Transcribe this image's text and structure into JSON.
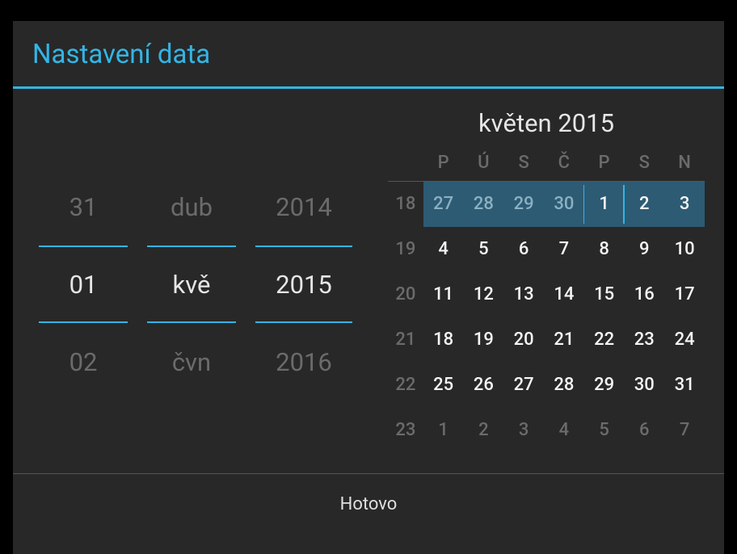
{
  "dialog": {
    "title": "Nastavení data",
    "done_label": "Hotovo"
  },
  "picker": {
    "day": {
      "prev": "31",
      "sel": "01",
      "next": "02"
    },
    "month": {
      "prev": "dub",
      "sel": "kvě",
      "next": "čvn"
    },
    "year": {
      "prev": "2014",
      "sel": "2015",
      "next": "2016"
    }
  },
  "calendar": {
    "month_label": "květen 2015",
    "weekday_short": [
      "P",
      "Ú",
      "S",
      "Č",
      "P",
      "S",
      "N"
    ],
    "weeks": [
      {
        "num": "18",
        "days": [
          {
            "d": "27",
            "other": true,
            "sel": true
          },
          {
            "d": "28",
            "other": true,
            "sel": true
          },
          {
            "d": "29",
            "other": true,
            "sel": true
          },
          {
            "d": "30",
            "other": true,
            "sel": true,
            "sep": true
          },
          {
            "d": "1",
            "other": false,
            "sel": true,
            "sep": true
          },
          {
            "d": "2",
            "other": false,
            "sel": true
          },
          {
            "d": "3",
            "other": false,
            "sel": true
          }
        ]
      },
      {
        "num": "19",
        "days": [
          {
            "d": "4"
          },
          {
            "d": "5"
          },
          {
            "d": "6"
          },
          {
            "d": "7"
          },
          {
            "d": "8"
          },
          {
            "d": "9"
          },
          {
            "d": "10"
          }
        ]
      },
      {
        "num": "20",
        "days": [
          {
            "d": "11"
          },
          {
            "d": "12"
          },
          {
            "d": "13"
          },
          {
            "d": "14"
          },
          {
            "d": "15"
          },
          {
            "d": "16"
          },
          {
            "d": "17"
          }
        ]
      },
      {
        "num": "21",
        "days": [
          {
            "d": "18"
          },
          {
            "d": "19"
          },
          {
            "d": "20"
          },
          {
            "d": "21"
          },
          {
            "d": "22"
          },
          {
            "d": "23"
          },
          {
            "d": "24"
          }
        ]
      },
      {
        "num": "22",
        "days": [
          {
            "d": "25"
          },
          {
            "d": "26"
          },
          {
            "d": "27"
          },
          {
            "d": "28"
          },
          {
            "d": "29"
          },
          {
            "d": "30"
          },
          {
            "d": "31"
          }
        ]
      },
      {
        "num": "23",
        "days": [
          {
            "d": "1",
            "other": true
          },
          {
            "d": "2",
            "other": true
          },
          {
            "d": "3",
            "other": true
          },
          {
            "d": "4",
            "other": true
          },
          {
            "d": "5",
            "other": true
          },
          {
            "d": "6",
            "other": true
          },
          {
            "d": "7",
            "other": true
          }
        ]
      }
    ]
  }
}
